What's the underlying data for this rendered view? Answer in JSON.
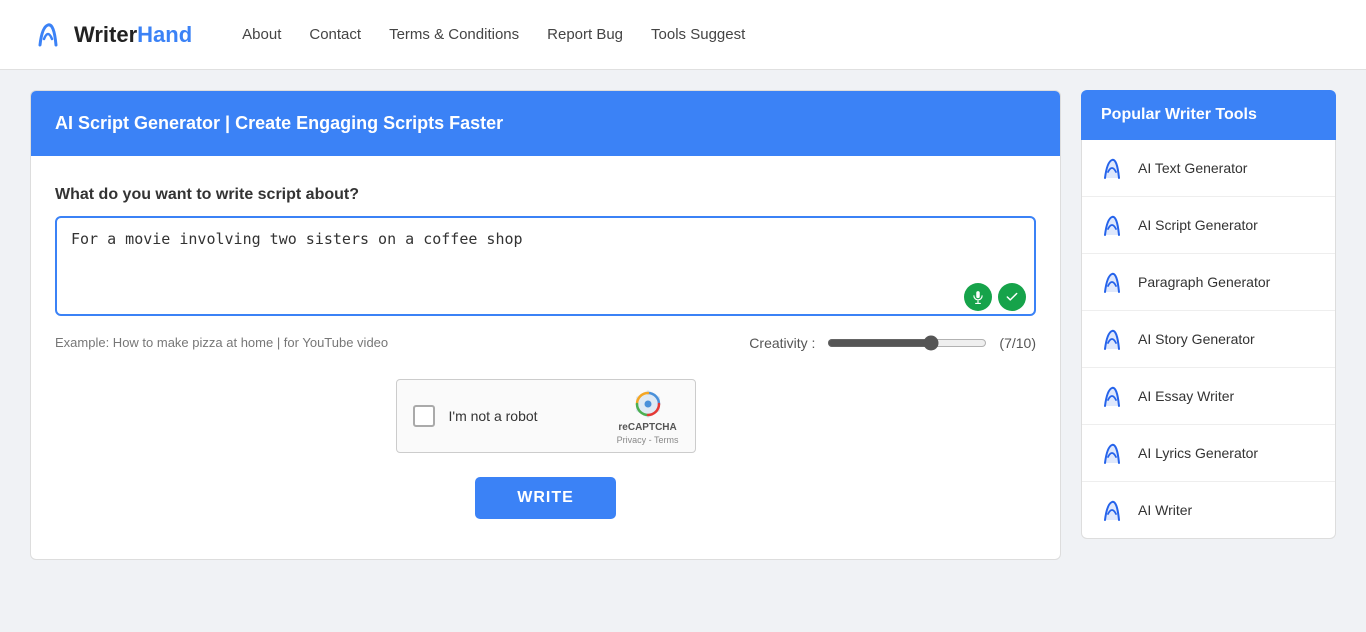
{
  "navbar": {
    "logo_writer": "Writer",
    "logo_hand": "Hand",
    "links": [
      {
        "id": "about",
        "label": "About"
      },
      {
        "id": "contact",
        "label": "Contact"
      },
      {
        "id": "terms",
        "label": "Terms & Conditions"
      },
      {
        "id": "report-bug",
        "label": "Report Bug"
      },
      {
        "id": "tools-suggest",
        "label": "Tools Suggest"
      }
    ]
  },
  "left_panel": {
    "header": "AI Script Generator | Create Engaging Scripts Faster",
    "field_label": "What do you want to write script about?",
    "textarea_value": "For a movie involving two sisters on a coffee shop",
    "example_text": "Example: How to make pizza at home | for YouTube video",
    "creativity_label": "Creativity :",
    "creativity_value": "(7/10)",
    "write_button": "WRITE"
  },
  "captcha": {
    "label": "I'm not a robot",
    "brand": "reCAPTCHA",
    "privacy": "Privacy",
    "terms": "Terms"
  },
  "right_panel": {
    "header": "Popular Writer Tools",
    "tools": [
      {
        "id": "ai-text-generator",
        "name": "AI Text Generator"
      },
      {
        "id": "ai-script-generator",
        "name": "AI Script Generator"
      },
      {
        "id": "paragraph-generator",
        "name": "Paragraph Generator"
      },
      {
        "id": "ai-story-generator",
        "name": "AI Story Generator"
      },
      {
        "id": "ai-essay-writer",
        "name": "AI Essay Writer"
      },
      {
        "id": "ai-lyrics-generator",
        "name": "AI Lyrics Generator"
      },
      {
        "id": "ai-writer",
        "name": "AI Writer"
      }
    ]
  },
  "colors": {
    "accent": "#3b82f6",
    "green": "#16a34a"
  }
}
